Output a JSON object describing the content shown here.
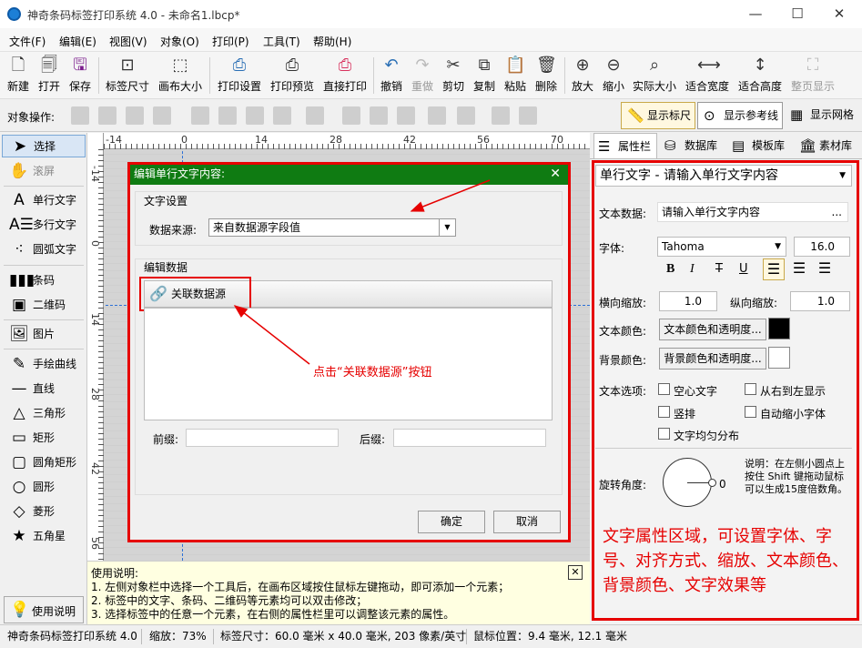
{
  "window": {
    "title": "神奇条码标签打印系统 4.0 - 未命名1.lbcp*",
    "minimize": "—",
    "maximize": "☐",
    "close": "✕"
  },
  "menu": [
    "文件(F)",
    "编辑(E)",
    "视图(V)",
    "对象(O)",
    "打印(P)",
    "工具(T)",
    "帮助(H)"
  ],
  "toolbar": [
    {
      "label": "新建",
      "icon": "new-file-icon"
    },
    {
      "label": "打开",
      "icon": "open-icon"
    },
    {
      "label": "保存",
      "icon": "save-icon"
    },
    {
      "label": "标签尺寸",
      "icon": "label-size-icon"
    },
    {
      "label": "画布大小",
      "icon": "canvas-size-icon"
    },
    {
      "label": "打印设置",
      "icon": "print-settings-icon"
    },
    {
      "label": "打印预览",
      "icon": "print-preview-icon"
    },
    {
      "label": "直接打印",
      "icon": "print-icon"
    },
    {
      "label": "撤销",
      "icon": "undo-icon"
    },
    {
      "label": "重做",
      "icon": "redo-icon"
    },
    {
      "label": "剪切",
      "icon": "cut-icon"
    },
    {
      "label": "复制",
      "icon": "copy-icon"
    },
    {
      "label": "粘贴",
      "icon": "paste-icon"
    },
    {
      "label": "删除",
      "icon": "delete-icon"
    },
    {
      "label": "放大",
      "icon": "zoom-in-icon"
    },
    {
      "label": "缩小",
      "icon": "zoom-out-icon"
    },
    {
      "label": "实际大小",
      "icon": "actual-size-icon"
    },
    {
      "label": "适合宽度",
      "icon": "fit-width-icon"
    },
    {
      "label": "适合高度",
      "icon": "fit-height-icon"
    },
    {
      "label": "整页显示",
      "icon": "full-page-icon"
    }
  ],
  "ops": {
    "label": "对象操作:",
    "show_ruler": "显示标尺",
    "show_guides": "显示参考线",
    "show_grid": "显示网格"
  },
  "tools": [
    {
      "label": "选择",
      "icon": "pointer-icon"
    },
    {
      "label": "滚屏",
      "icon": "hand-icon"
    },
    {
      "label": "单行文字",
      "icon": "single-text-icon"
    },
    {
      "label": "多行文字",
      "icon": "multi-text-icon"
    },
    {
      "label": "圆弧文字",
      "icon": "arc-text-icon"
    },
    {
      "label": "条码",
      "icon": "barcode-icon"
    },
    {
      "label": "二维码",
      "icon": "qrcode-icon"
    },
    {
      "label": "图片",
      "icon": "image-icon"
    },
    {
      "label": "手绘曲线",
      "icon": "pen-icon"
    },
    {
      "label": "直线",
      "icon": "line-icon"
    },
    {
      "label": "三角形",
      "icon": "triangle-icon"
    },
    {
      "label": "矩形",
      "icon": "rectangle-icon"
    },
    {
      "label": "圆角矩形",
      "icon": "rounded-rect-icon"
    },
    {
      "label": "圆形",
      "icon": "circle-icon"
    },
    {
      "label": "菱形",
      "icon": "diamond-icon"
    },
    {
      "label": "五角星",
      "icon": "star-icon"
    }
  ],
  "help_button": "使用说明",
  "rulers": {
    "h": [
      "-14",
      "0",
      "14",
      "28",
      "42",
      "56",
      "70"
    ],
    "v": [
      "-14",
      "0",
      "14",
      "28",
      "42",
      "56"
    ]
  },
  "help": {
    "title": "使用说明:",
    "lines": [
      "1. 左侧对象栏中选择一个工具后，在画布区域按住鼠标左键拖动，即可添加一个元素；",
      "2. 标签中的文字、条码、二维码等元素均可以双击修改；",
      "3. 选择标签中的任意一个元素，在右侧的属性栏里可以调整该元素的属性。"
    ],
    "close": "✕"
  },
  "dialog": {
    "title": "编辑单行文字内容:",
    "close": "✕",
    "text_settings": "文字设置",
    "data_source_label": "数据来源:",
    "data_source_value": "来自数据源字段值",
    "edit_data": "编辑数据",
    "link_button": "关联数据源",
    "prefix_label": "前缀:",
    "suffix_label": "后缀:",
    "ok": "确定",
    "cancel": "取消",
    "annotation": "点击“关联数据源”按钮"
  },
  "rpanel": {
    "tabs": [
      "属性栏",
      "数据库",
      "模板库",
      "素材库"
    ],
    "object_select": "单行文字 - 请输入单行文字内容",
    "text_data_label": "文本数据:",
    "text_data_value": "请输入单行文字内容",
    "more": "...",
    "font_label": "字体:",
    "font_value": "Tahoma",
    "size_value": "16.0",
    "bold": "B",
    "italic": "I",
    "strike": "T",
    "underline": "U",
    "hscale_label": "横向缩放:",
    "hscale_value": "1.0",
    "vscale_label": "纵向缩放:",
    "vscale_value": "1.0",
    "text_color_label": "文本颜色:",
    "text_color_btn": "文本颜色和透明度...",
    "bg_color_label": "背景颜色:",
    "bg_color_btn": "背景颜色和透明度...",
    "text_options_label": "文本选项:",
    "opt_hollow": "空心文字",
    "opt_rtl": "从右到左显示",
    "opt_vertical": "竖排",
    "opt_autoshrink": "自动缩小字体",
    "opt_even": "文字均匀分布",
    "rotation_label": "旋转角度:",
    "rotation_value": "0",
    "rotation_note": "说明：在左侧小圆点上按住 Shift 键拖动鼠标可以生成15度倍数角。",
    "annotation": "文字属性区域，可设置字体、字号、对齐方式、缩放、文本颜色、背景颜色、文字效果等",
    "text_color": "#000000",
    "bg_color": "#ffffff"
  },
  "status": {
    "app": "神奇条码标签打印系统 4.0",
    "zoom": "缩放：73%",
    "label_size": "标签尺寸：60.0 毫米 x 40.0 毫米, 203 像素/英寸",
    "mouse_pos": "鼠标位置：9.4 毫米, 12.1 毫米"
  }
}
